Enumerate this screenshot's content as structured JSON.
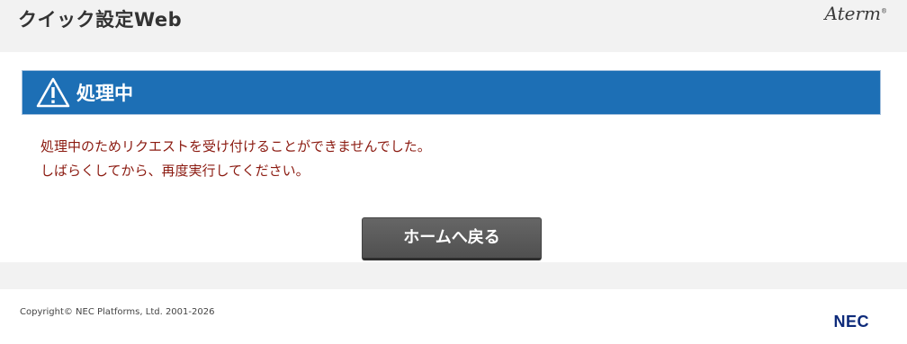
{
  "header": {
    "title": "クイック設定Web",
    "brand": "Aterm",
    "brand_mark": "®"
  },
  "status": {
    "icon": "warning-icon",
    "title": "処理中",
    "color": "#1d6fb5"
  },
  "message": {
    "line1": "処理中のためリクエストを受け付けることができませんでした。",
    "line2": "しばらくしてから、再度実行してください。",
    "color": "#8b1a10"
  },
  "actions": {
    "home_label": "ホームへ戻る"
  },
  "footer": {
    "copyright": "Copyright© NEC Platforms, Ltd. 2001-2026",
    "logo": "NEC"
  }
}
